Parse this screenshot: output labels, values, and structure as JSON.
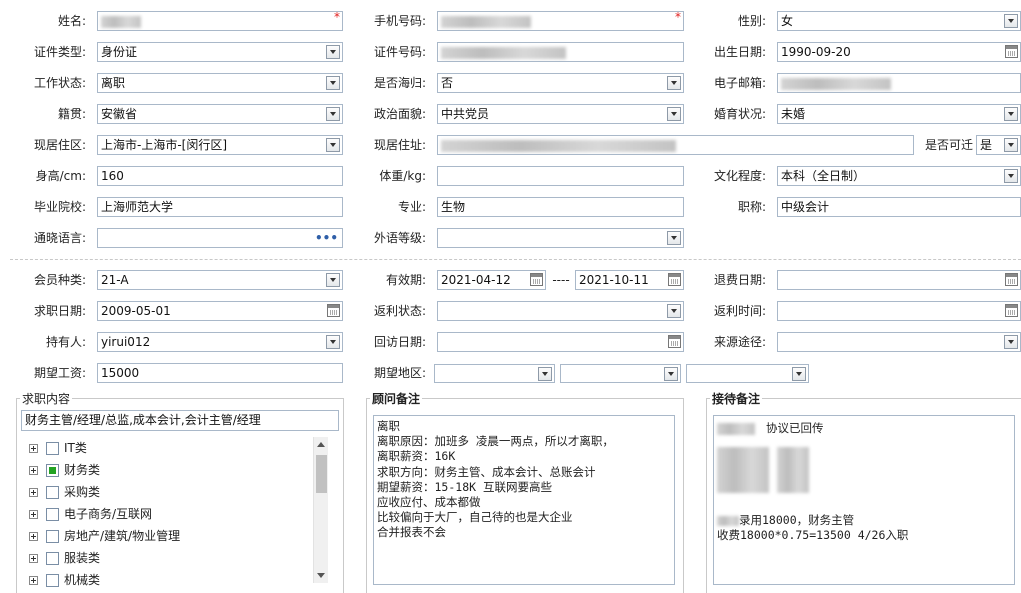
{
  "basic": {
    "name": {
      "label": "姓名:",
      "required_mark": "*"
    },
    "phone": {
      "label": "手机号码:",
      "required_mark": "*"
    },
    "gender": {
      "label": "性别:",
      "value": "女"
    },
    "id_type": {
      "label": "证件类型:",
      "value": "身份证"
    },
    "id_number": {
      "label": "证件号码:"
    },
    "birth_date": {
      "label": "出生日期:",
      "value": "1990-09-20"
    },
    "work_status": {
      "label": "工作状态:",
      "value": "离职"
    },
    "returnee": {
      "label": "是否海归:",
      "value": "否"
    },
    "email": {
      "label": "电子邮箱:"
    },
    "native_place": {
      "label": "籍贯:",
      "value": "安徽省"
    },
    "political": {
      "label": "政治面貌:",
      "value": "中共党员"
    },
    "marital": {
      "label": "婚育状况:",
      "value": "未婚"
    },
    "residence_area": {
      "label": "现居住区:",
      "value": "上海市-上海市-[闵行区]"
    },
    "residence_address": {
      "label": "现居住址:"
    },
    "relocatable": {
      "label": "是否可迁",
      "value": "是"
    },
    "height": {
      "label": "身高/cm:",
      "value": "160"
    },
    "weight": {
      "label": "体重/kg:",
      "value": ""
    },
    "education": {
      "label": "文化程度:",
      "value": "本科（全日制）"
    },
    "school": {
      "label": "毕业院校:",
      "value": "上海师范大学"
    },
    "major": {
      "label": "专业:",
      "value": "生物"
    },
    "title": {
      "label": "职称:",
      "value": "中级会计"
    },
    "languages": {
      "label": "通晓语言:",
      "value": "",
      "more": "•••"
    },
    "foreign_level": {
      "label": "外语等级:",
      "value": ""
    }
  },
  "membership": {
    "member_type": {
      "label": "会员种类:",
      "value": "21-A"
    },
    "valid_period": {
      "label": "有效期:",
      "start": "2021-04-12",
      "sep": "----",
      "end": "2021-10-11"
    },
    "refund_date": {
      "label": "退费日期:",
      "value": ""
    },
    "job_seek_date": {
      "label": "求职日期:",
      "value": "2009-05-01"
    },
    "rebate_status": {
      "label": "返利状态:",
      "value": ""
    },
    "rebate_time": {
      "label": "返利时间:",
      "value": ""
    },
    "holder": {
      "label": "持有人:",
      "value": "yirui012"
    },
    "visit_date": {
      "label": "回访日期:",
      "value": ""
    },
    "source": {
      "label": "来源途径:",
      "value": ""
    },
    "expected_salary": {
      "label": "期望工资:",
      "value": "15000"
    },
    "expected_region": {
      "label": "期望地区:",
      "values": [
        "",
        "",
        ""
      ]
    }
  },
  "job_content": {
    "title": "求职内容",
    "summary": "财务主管/经理/总监,成本会计,会计主管/经理",
    "categories": [
      {
        "label": "IT类",
        "checked": false
      },
      {
        "label": "财务类",
        "checked": true
      },
      {
        "label": "采购类",
        "checked": false
      },
      {
        "label": "电子商务/互联网",
        "checked": false
      },
      {
        "label": "房地产/建筑/物业管理",
        "checked": false
      },
      {
        "label": "服装类",
        "checked": false
      },
      {
        "label": "机械类",
        "checked": false
      }
    ]
  },
  "advisor_notes": {
    "title": "顾问备注",
    "lines": [
      "离职",
      "离职原因：加班多  凌晨一两点，所以才离职，",
      "离职薪资：16K",
      "求职方向：财务主管、成本会计、总账会计",
      "期望薪资：15-18K  互联网要高些",
      "应收应付、成本都做",
      "比较偏向于大厂，自己待的也是大企业",
      "合并报表不会"
    ]
  },
  "reception_notes": {
    "title": "接待备注",
    "line1": "协议已回传",
    "line2": "录用18000，财务主管",
    "line3": "收费18000*0.75=13500 4/26入职"
  }
}
